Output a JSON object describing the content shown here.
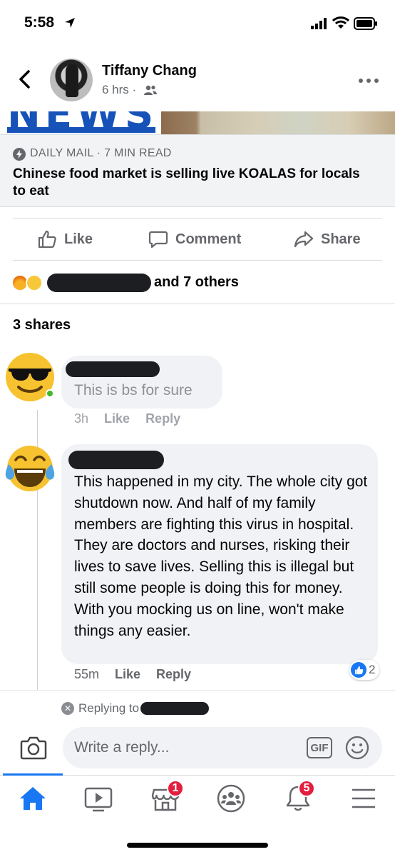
{
  "status_bar": {
    "time": "5:58"
  },
  "post": {
    "author": "Tiffany Chang",
    "time_meta": "6 hrs ·",
    "link_preview": {
      "image_text": "NEWS",
      "source": "DAILY MAIL · 7 MIN READ",
      "headline": "Chinese food market is selling live KOALAS for locals to eat"
    },
    "actions": {
      "like": "Like",
      "comment": "Comment",
      "share": "Share"
    },
    "reactions_summary": "and 7 others",
    "shares": "3 shares"
  },
  "comments": [
    {
      "text": "This is bs for sure",
      "time": "3h",
      "like_label": "Like",
      "reply_label": "Reply"
    },
    {
      "text": "This happened in my city. The whole city got shutdown now. And half of my family members are fighting this virus in hospital.  They are doctors and nurses, risking their lives to save lives. Selling this is illegal but still some people is doing this for money.  With you mocking us on line, won't make things any easier.",
      "time": "55m",
      "like_label": "Like",
      "reply_label": "Reply",
      "like_count": "2"
    }
  ],
  "composer": {
    "replying_to": "Replying to",
    "placeholder": "Write a reply...",
    "gif_label": "GIF"
  },
  "tab_bar": {
    "marketplace_badge": "1",
    "notifications_badge": "5"
  },
  "colors": {
    "accent": "#1877f2",
    "badge": "#e41e3f",
    "news_blue": "#1652b8"
  }
}
